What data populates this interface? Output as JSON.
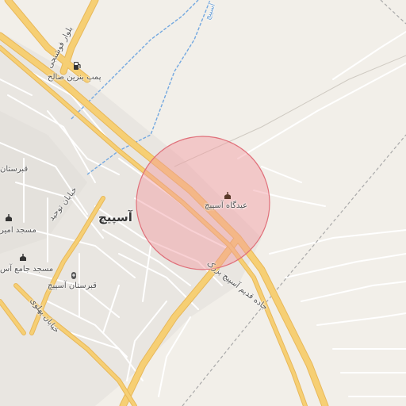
{
  "labels": {
    "city": "آسپیچ",
    "gas_station": "پمپ بنزین صالح",
    "eidgah": "عیدگاه آسپیچ",
    "cemetery": "قبرستان آسپیچ",
    "mosque_jame": "مسجد جامع آس",
    "mosque_amir": "مسجد امیر",
    "cemetery_left": "قبرستان",
    "road_old": "جاده قدیم آسپیچ بزرک",
    "road_boulevard": "بلوار فوشنجی",
    "road_tohid": "خیابان توحید",
    "road_pahlavi": "خیابان پهلوی",
    "water_edge": "آسپیچ"
  },
  "icons": {
    "gas": "fuel-pump-icon",
    "eidgah": "mosque-icon",
    "cemetery": "cemetery-icon",
    "mosque1": "mosque-icon",
    "mosque2": "mosque-icon"
  },
  "colors": {
    "background": "#f2efe9",
    "major_road": "#f6cf74",
    "minor_road": "#ffffff",
    "water": "#73a8e0",
    "highlight_fill": "#f19aa0",
    "highlight_stroke": "#e0707a",
    "rail": "#a9a9a9"
  }
}
